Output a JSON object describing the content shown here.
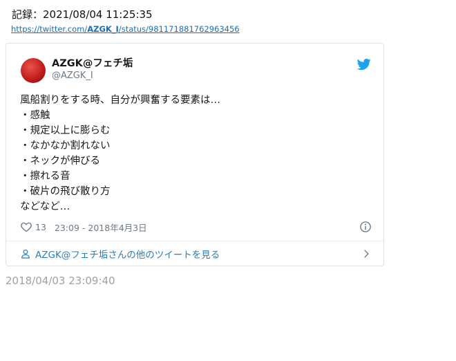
{
  "record": "記録：2021/08/04 11:25:35",
  "url": {
    "prefix": "https://twitter.com/",
    "user": "AZGK_I",
    "suffix": "/status/981171881762963456"
  },
  "tweet": {
    "name": "AZGK@フェチ垢",
    "handle": "@AZGK_I",
    "lines": [
      "風船割りをする時、自分が興奮する要素は…",
      "・感触",
      "・規定以上に膨らむ",
      "・なかなか割れない",
      "・ネックが伸びる",
      "・擦れる音",
      "・破片の飛び散り方",
      "などなど…"
    ],
    "likes": "13",
    "timestamp": "23:09 - 2018年4月3日",
    "more_link": "AZGK@フェチ垢さんの他のツイートを見る"
  },
  "footer_date": "2018/04/03 23:09:40",
  "icons": {
    "bird": "twitter-bird-icon",
    "heart": "heart-icon",
    "info": "info-icon",
    "person": "person-icon",
    "chevron": "chevron-right-icon"
  },
  "colors": {
    "twitter_blue": "#1da1f2",
    "link": "#2b7bb9",
    "muted": "#697882"
  }
}
